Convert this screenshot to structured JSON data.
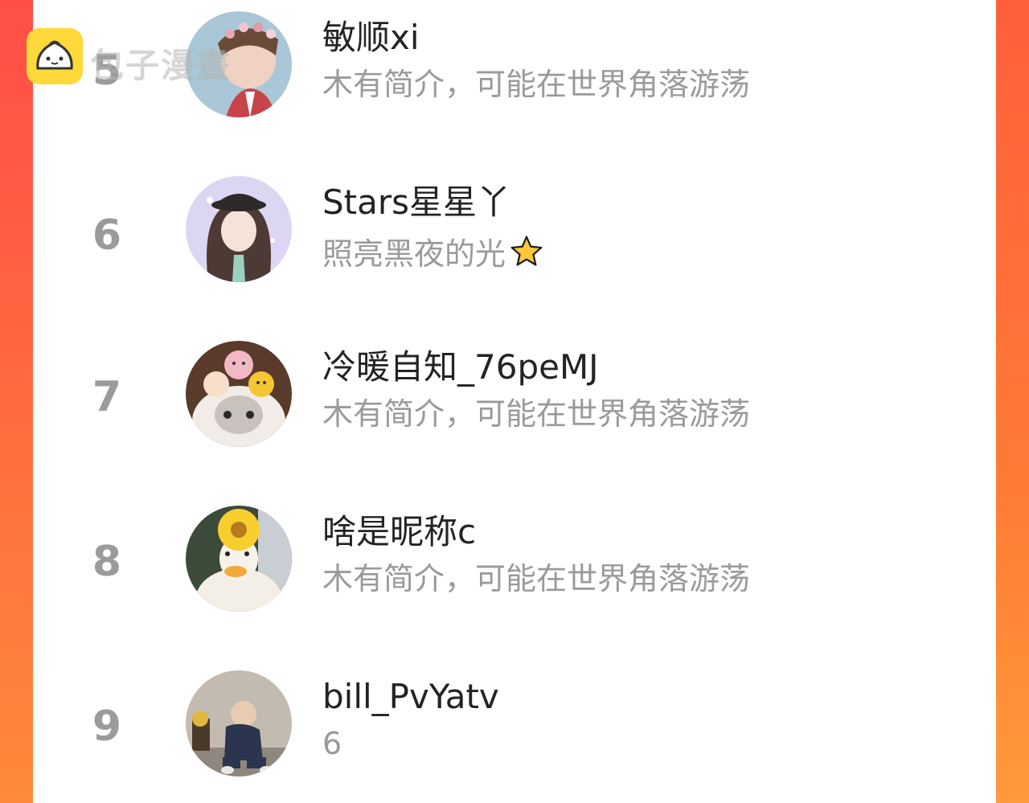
{
  "watermark": {
    "text": "包子漫畫"
  },
  "rows": [
    {
      "rank": "5",
      "name": "敏顺xi",
      "bio": "木有简介，可能在世界角落游荡",
      "avatar": "boy-with-flower-crown"
    },
    {
      "rank": "6",
      "name": "Stars星星丫",
      "bio": "照亮黑夜的光",
      "bio_emoji": "star-emoji",
      "avatar": "anime-girl-with-hat"
    },
    {
      "rank": "7",
      "name": "冷暖自知_76peMJ",
      "bio": "木有简介，可能在世界角落游荡",
      "avatar": "cat-with-plush-toys"
    },
    {
      "rank": "8",
      "name": "啥是昵称c",
      "bio": "木有简介，可能在世界角落游荡",
      "avatar": "duck-with-sunflower-hat"
    },
    {
      "rank": "9",
      "name": "bill_PvYatv",
      "bio": "6",
      "avatar": "child-sitting-on-floor"
    }
  ],
  "colors": {
    "accent_left": "#ff4e47",
    "accent_right": "#ff8a3a",
    "rank": "#9b9b9b",
    "name": "#232323",
    "bio": "#9a9a9a",
    "logo": "#ffd93a"
  }
}
